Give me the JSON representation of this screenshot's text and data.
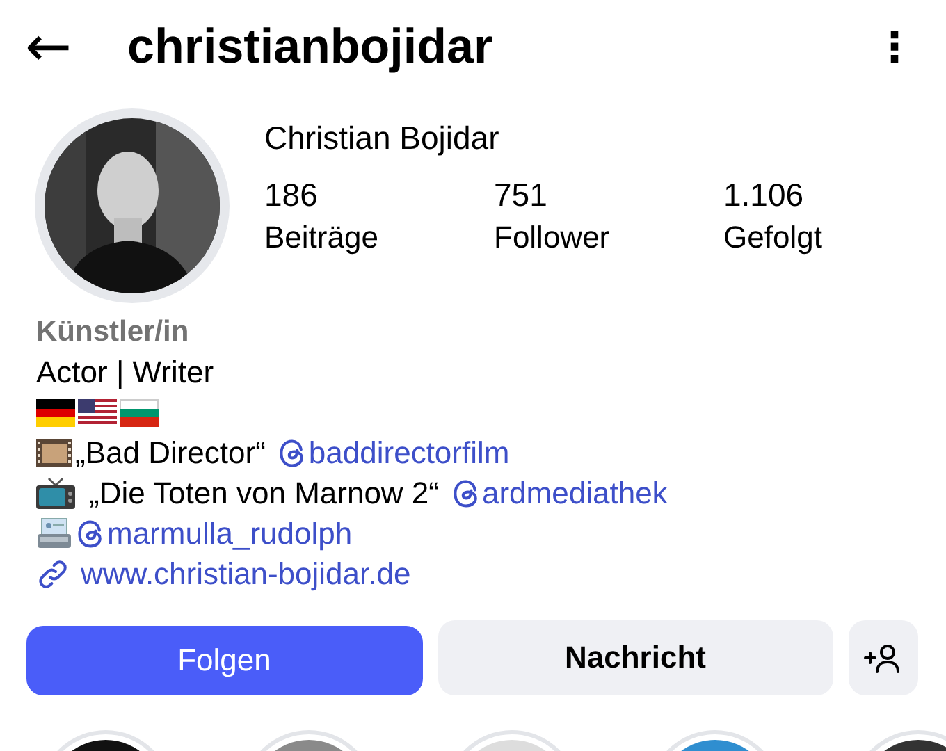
{
  "header": {
    "back": "←",
    "username": "christianbojidar",
    "menu": "⋮"
  },
  "profile": {
    "name": "Christian Bojidar",
    "stats": [
      {
        "value": "186",
        "label": "Beiträge"
      },
      {
        "value": "751",
        "label": "Follower"
      },
      {
        "value": "1.106",
        "label": "Gefolgt"
      }
    ]
  },
  "bio": {
    "category": "Künstler/in",
    "lines": [
      {
        "kind": "plain",
        "text": "Actor | Writer"
      },
      {
        "kind": "flags"
      },
      {
        "kind": "film",
        "text": "„Bad Director“",
        "mention": "baddirectorfilm"
      },
      {
        "kind": "tv",
        "text": "„Die Toten von Marnow 2“",
        "mention": "ardmediathek"
      },
      {
        "kind": "contact",
        "mention": "marmulla_rudolph"
      },
      {
        "kind": "link",
        "text": "www.christian-bojidar.de"
      }
    ]
  },
  "actions": [
    {
      "kind": "primary",
      "label": "Folgen"
    },
    {
      "kind": "secondary",
      "label": "Nachricht"
    },
    {
      "kind": "add-person"
    }
  ]
}
